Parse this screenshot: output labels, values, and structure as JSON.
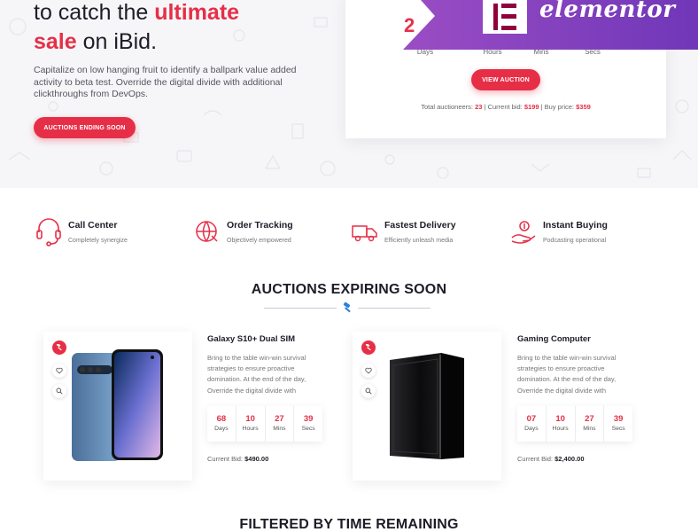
{
  "hero": {
    "title_line1": "to catch the",
    "title_highlight1": "ultimate",
    "title_highlight2": "sale",
    "title_line2_rest": "on iBid.",
    "description": "Capitalize on low hanging fruit to identify a ballpark value added activity to beta test. Override the digital divide with additional clickthroughs from DevOps.",
    "button_label": "AUCTIONS ENDING SOON"
  },
  "countdown": {
    "first_digit": "2",
    "labels": [
      "Days",
      "Hours",
      "Mins",
      "Secs"
    ],
    "button_label": "VIEW AUCTION",
    "info_prefix": "Total auctioneers:",
    "auctioneers": "23",
    "current_bid_prefix": "| Current bid:",
    "current_bid": "$199",
    "buy_price_prefix": "| Buy price:",
    "buy_price": "$359"
  },
  "banner": {
    "brand": "elementor"
  },
  "features": [
    {
      "title": "Call Center",
      "subtitle": "Completely synergize",
      "icon": "headset-icon"
    },
    {
      "title": "Order Tracking",
      "subtitle": "Objectively empowered",
      "icon": "globe-tracking-icon"
    },
    {
      "title": "Fastest Delivery",
      "subtitle": "Efficiently unleash media",
      "icon": "truck-icon"
    },
    {
      "title": "Instant Buying",
      "subtitle": "Podcasting operational",
      "icon": "hand-money-icon"
    }
  ],
  "auctions_section": {
    "title": "AUCTIONS EXPIRING SOON"
  },
  "products": [
    {
      "name": "Galaxy S10+ Dual SIM",
      "description": "Bring to the table win-win survival strategies to ensure proactive domination. At the end of the day, Override the digital divide with",
      "timer": [
        {
          "value": "68",
          "label": "Days"
        },
        {
          "value": "10",
          "label": "Hours"
        },
        {
          "value": "27",
          "label": "Mins"
        },
        {
          "value": "39",
          "label": "Secs"
        }
      ],
      "bid_label": "Current Bid:",
      "bid_value": "$490.00"
    },
    {
      "name": "Gaming Computer",
      "description": "Bring to the table win-win survival strategies to ensure proactive domination. At the end of the day, Override the digital divide with",
      "timer": [
        {
          "value": "07",
          "label": "Days"
        },
        {
          "value": "10",
          "label": "Hours"
        },
        {
          "value": "27",
          "label": "Mins"
        },
        {
          "value": "39",
          "label": "Secs"
        }
      ],
      "bid_label": "Current Bid:",
      "bid_value": "$2,400.00"
    }
  ],
  "filtered_section": {
    "title": "FILTERED BY TIME REMAINING"
  },
  "colors": {
    "accent": "#e62f47",
    "banner": "#7b3fc0",
    "dark": "#1d1d28"
  }
}
